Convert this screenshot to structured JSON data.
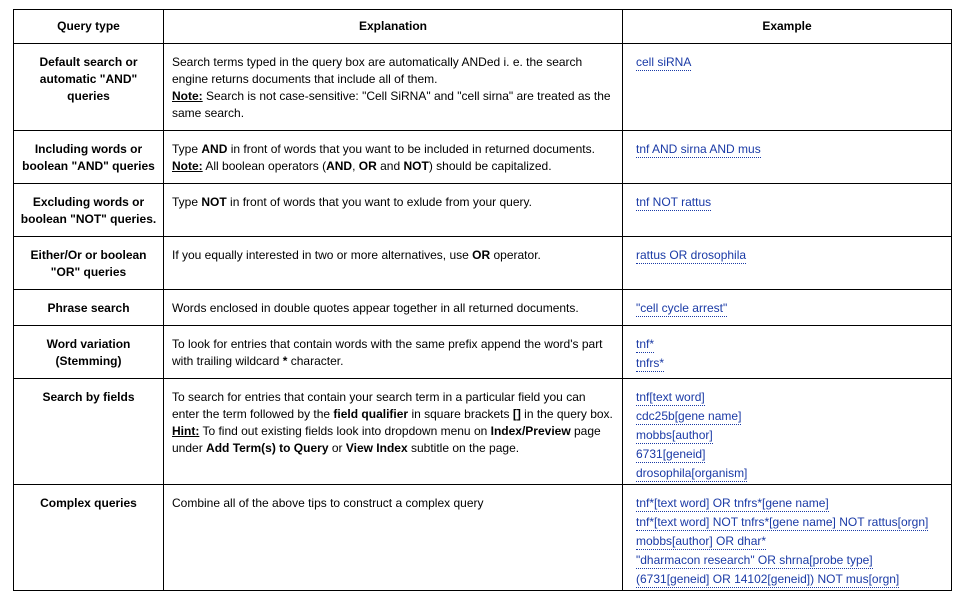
{
  "headers": {
    "query_type": "Query type",
    "explanation": "Explanation",
    "example": "Example"
  },
  "rows": [
    {
      "query_type": "Default search or automatic \"AND\" queries",
      "explanation": [
        {
          "t": "Search terms typed in the query box are automatically ANDed i. e. the search engine returns documents that include all of them."
        },
        {
          "br": true
        },
        {
          "t": "Note:",
          "s": "note"
        },
        {
          "t": " Search is not case-sensitive: \"Cell SiRNA\" and \"cell sirna\" are treated as the same search."
        }
      ],
      "examples": [
        "cell siRNA"
      ]
    },
    {
      "query_type": "Including words or boolean \"AND\" queries",
      "explanation": [
        {
          "t": "Type "
        },
        {
          "t": "AND",
          "s": "tok"
        },
        {
          "t": " in front of words that you want to be included in returned documents."
        },
        {
          "br": true
        },
        {
          "t": "Note:",
          "s": "note"
        },
        {
          "t": " All boolean operators ("
        },
        {
          "t": "AND",
          "s": "tok"
        },
        {
          "t": ", "
        },
        {
          "t": "OR",
          "s": "tok"
        },
        {
          "t": " and "
        },
        {
          "t": "NOT",
          "s": "tok"
        },
        {
          "t": ") should be capitalized."
        }
      ],
      "examples": [
        "tnf AND sirna AND mus"
      ]
    },
    {
      "query_type": "Excluding words or boolean \"NOT\" queries.",
      "explanation": [
        {
          "t": "Type "
        },
        {
          "t": "NOT",
          "s": "tok"
        },
        {
          "t": " in front of words that you want to exlude from your query."
        }
      ],
      "examples": [
        "tnf NOT rattus"
      ]
    },
    {
      "query_type": "Either/Or or boolean \"OR\" queries",
      "explanation": [
        {
          "t": "If you equally interested in two or more alternatives, use "
        },
        {
          "t": "OR",
          "s": "tok"
        },
        {
          "t": " operator."
        }
      ],
      "examples": [
        "rattus OR drosophila"
      ]
    },
    {
      "query_type": "Phrase search",
      "explanation": [
        {
          "t": "Words enclosed in double quotes appear together in all returned documents."
        }
      ],
      "examples": [
        "\"cell cycle arrest\""
      ]
    },
    {
      "query_type": "Word variation (Stemming)",
      "explanation": [
        {
          "t": "To look for entries that contain words with the same prefix append the word's part with trailing wildcard "
        },
        {
          "t": "*",
          "s": "tok"
        },
        {
          "t": " character."
        }
      ],
      "examples": [
        "tnf*",
        "tnfrs*"
      ]
    },
    {
      "query_type": "Search by fields",
      "explanation": [
        {
          "t": "To search for entries that contain your search term in a particular field you can enter the term followed by the "
        },
        {
          "t": "field qualifier",
          "s": "tok"
        },
        {
          "t": " in square brackets "
        },
        {
          "t": "[]",
          "s": "tok"
        },
        {
          "t": " in the query box."
        },
        {
          "br": true
        },
        {
          "t": "Hint:",
          "s": "note"
        },
        {
          "t": " To find out existing fields look into dropdown menu on "
        },
        {
          "t": "Index/Preview",
          "s": "tok"
        },
        {
          "t": " page under "
        },
        {
          "t": "Add Term(s) to Query",
          "s": "tok"
        },
        {
          "t": " or "
        },
        {
          "t": "View Index",
          "s": "tok"
        },
        {
          "t": " subtitle on the page."
        }
      ],
      "examples": [
        "tnf[text word]",
        "cdc25b[gene name]",
        "mobbs[author]",
        "6731[geneid]",
        "drosophila[organism]"
      ]
    },
    {
      "query_type": "Complex queries",
      "explanation": [
        {
          "t": "Combine all of the above tips to construct a complex query"
        }
      ],
      "examples": [
        "tnf*[text word] OR tnfrs*[gene name]",
        "tnf*[text word] NOT tnfrs*[gene name] NOT rattus[orgn]",
        "mobbs[author] OR dhar*",
        "\"dharmacon research\" OR shrna[probe type]",
        "(6731[geneid] OR 14102[geneid]) NOT mus[orgn]"
      ]
    }
  ],
  "colors": {
    "link": "#1a3aa6",
    "border": "#000000"
  }
}
